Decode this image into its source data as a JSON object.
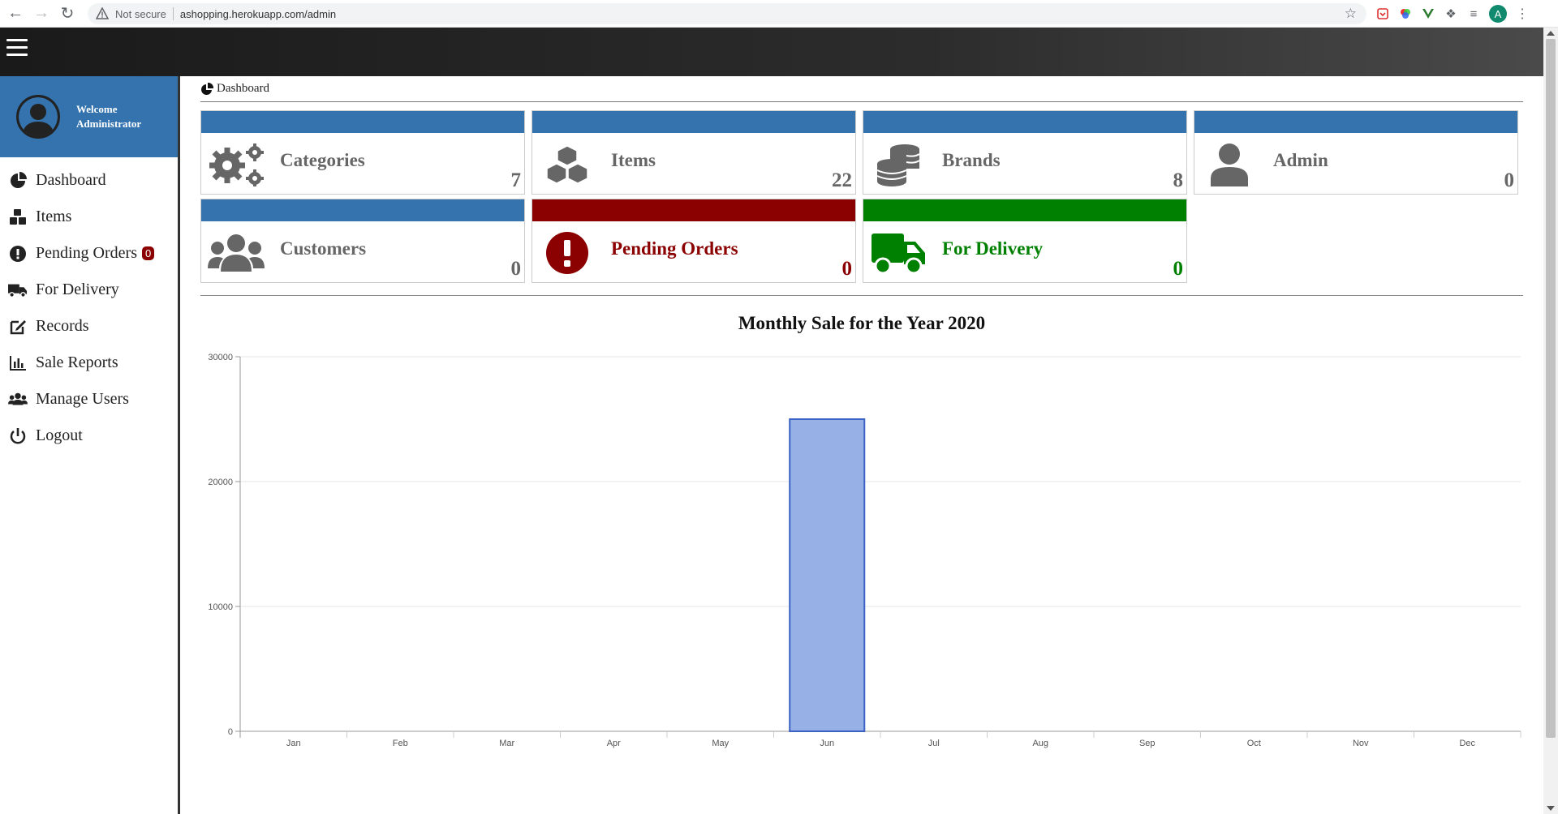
{
  "browser": {
    "security_label": "Not secure",
    "url": "ashopping.herokuapp.com/admin",
    "profile_initial": "A"
  },
  "sidebar": {
    "welcome_line1": "Welcome",
    "welcome_line2": "Administrator",
    "items": [
      {
        "label": "Dashboard",
        "icon": "pie-chart-icon"
      },
      {
        "label": "Items",
        "icon": "cubes-icon"
      },
      {
        "label": "Pending Orders",
        "icon": "exclamation-circle-icon",
        "badge": "0"
      },
      {
        "label": "For Delivery",
        "icon": "truck-icon"
      },
      {
        "label": "Records",
        "icon": "edit-icon"
      },
      {
        "label": "Sale Reports",
        "icon": "bar-chart-icon"
      },
      {
        "label": "Manage Users",
        "icon": "users-icon"
      },
      {
        "label": "Logout",
        "icon": "power-icon"
      }
    ]
  },
  "breadcrumb": {
    "label": "Dashboard"
  },
  "cards": [
    {
      "label": "Categories",
      "value": "7",
      "icon": "cogs-icon",
      "color": "#3473ad"
    },
    {
      "label": "Items",
      "value": "22",
      "icon": "cubes-icon",
      "color": "#3473ad"
    },
    {
      "label": "Brands",
      "value": "8",
      "icon": "database-icon",
      "color": "#3473ad"
    },
    {
      "label": "Admin",
      "value": "0",
      "icon": "user-icon",
      "color": "#3473ad"
    },
    {
      "label": "Customers",
      "value": "0",
      "icon": "users-icon",
      "color": "#3473ad"
    },
    {
      "label": "Pending Orders",
      "value": "0",
      "icon": "exclamation-circle-icon",
      "color": "#8b0000"
    },
    {
      "label": "For Delivery",
      "value": "0",
      "icon": "truck-icon",
      "color": "#008000"
    }
  ],
  "chart_data": {
    "type": "bar",
    "title": "Monthly Sale for the Year 2020",
    "categories": [
      "Jan",
      "Feb",
      "Mar",
      "Apr",
      "May",
      "Jun",
      "Jul",
      "Aug",
      "Sep",
      "Oct",
      "Nov",
      "Dec"
    ],
    "values": [
      0,
      0,
      0,
      0,
      0,
      25000,
      0,
      0,
      0,
      0,
      0,
      0
    ],
    "ylim": [
      0,
      30000
    ],
    "yticks": [
      0,
      10000,
      20000,
      30000
    ],
    "grid": true,
    "bar_color": "#97b1e6",
    "bar_border": "#3a62c4"
  }
}
